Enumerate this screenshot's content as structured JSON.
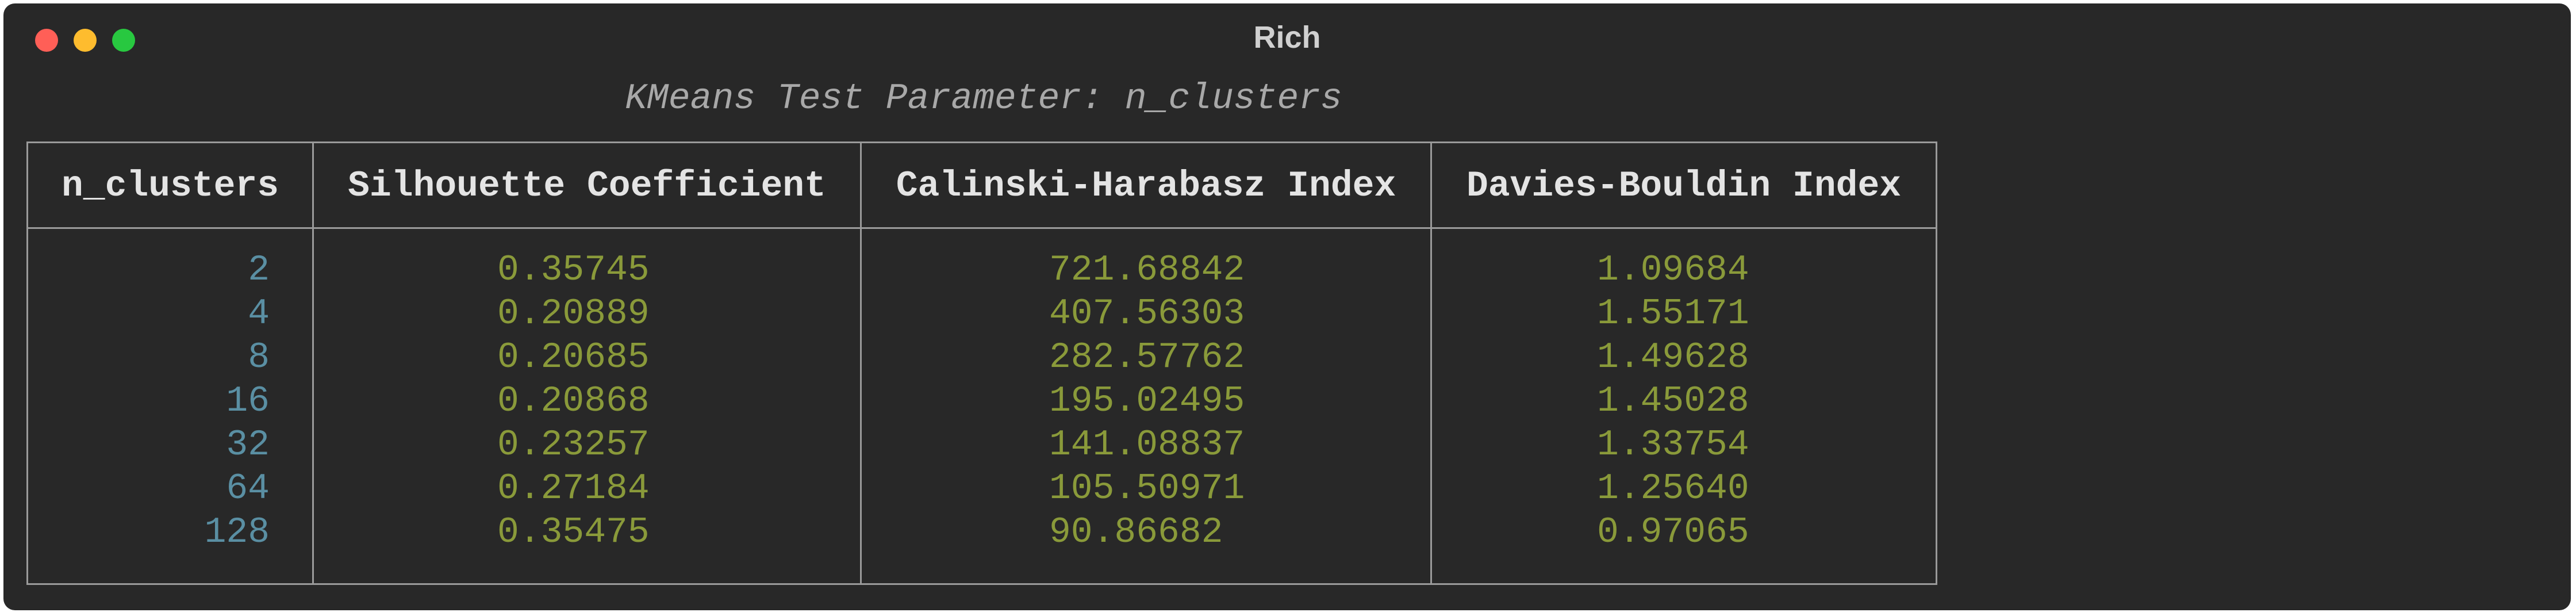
{
  "window": {
    "title": "Rich"
  },
  "table": {
    "caption": "KMeans Test Parameter: n_clusters",
    "headers": [
      "n_clusters",
      "Silhouette Coefficient",
      "Calinski-Harabasz Index",
      "Davies-Bouldin Index"
    ],
    "rows": [
      {
        "n_clusters": "2",
        "silhouette": "0.35745",
        "calinski": "721.68842",
        "davies": "1.09684"
      },
      {
        "n_clusters": "4",
        "silhouette": "0.20889",
        "calinski": "407.56303",
        "davies": "1.55171"
      },
      {
        "n_clusters": "8",
        "silhouette": "0.20685",
        "calinski": "282.57762",
        "davies": "1.49628"
      },
      {
        "n_clusters": "16",
        "silhouette": "0.20868",
        "calinski": "195.02495",
        "davies": "1.45028"
      },
      {
        "n_clusters": "32",
        "silhouette": "0.23257",
        "calinski": "141.08837",
        "davies": "1.33754"
      },
      {
        "n_clusters": "64",
        "silhouette": "0.27184",
        "calinski": "105.50971",
        "davies": "1.25640"
      },
      {
        "n_clusters": "128",
        "silhouette": "0.35475",
        "calinski": "90.86682",
        "davies": "0.97065"
      }
    ]
  },
  "colors": {
    "background": "#282828",
    "index_text": "#5a8fa3",
    "value_text": "#8a9a3a",
    "header_text": "#e4e4e4",
    "caption_text": "#a8a8a8",
    "border": "#9a9a9a"
  }
}
